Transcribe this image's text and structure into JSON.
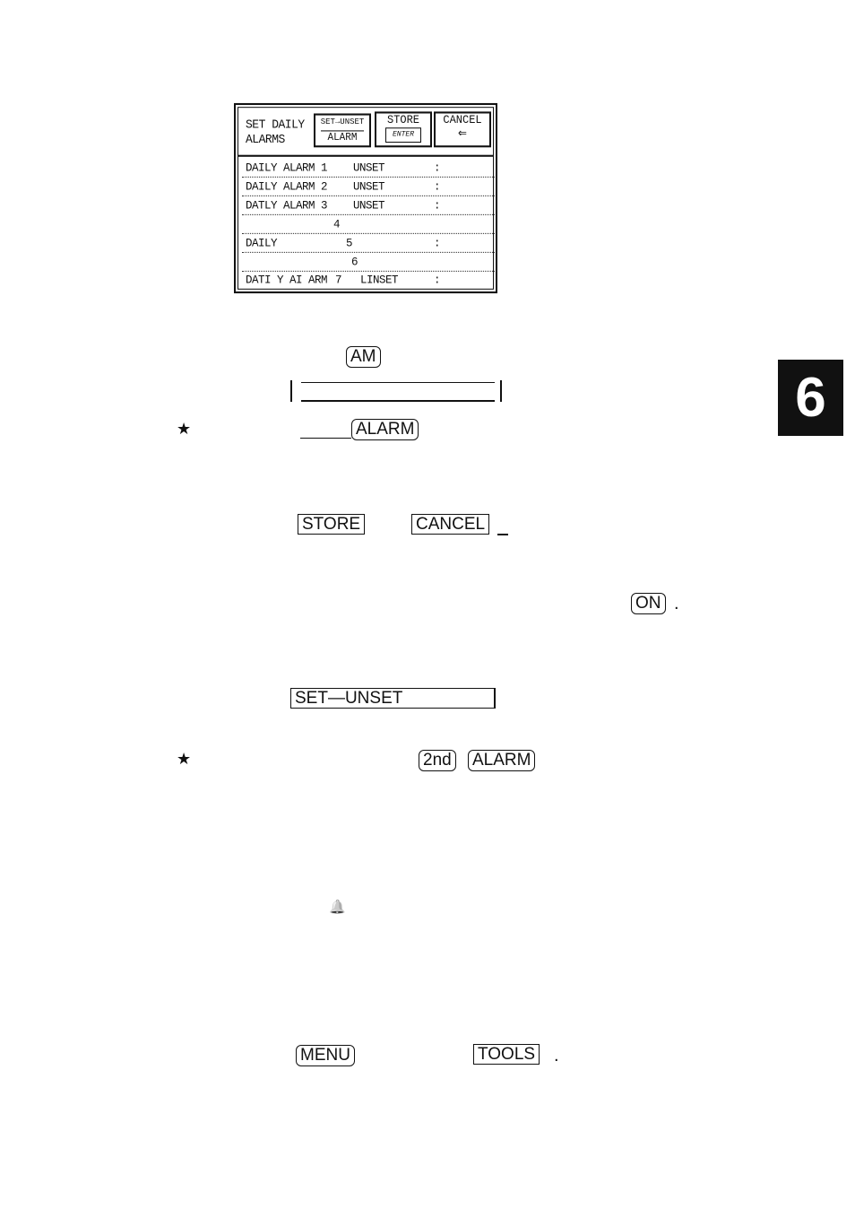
{
  "screen": {
    "title_line1": "SET DAILY",
    "title_line2": "ALARMS",
    "set_unset_key": {
      "top": "SET→UNSET",
      "bottom": "ALARM"
    },
    "store_key": {
      "label": "STORE",
      "sub": "ENTER"
    },
    "cancel_key": {
      "label": "CANCEL"
    },
    "rows": [
      {
        "name": "DAILY ALARM 1",
        "status": "UNSET",
        "time": ":"
      },
      {
        "name": "DAILY ALARM 2",
        "status": "UNSET",
        "time": ":"
      },
      {
        "name": "DATLY ALARM 3",
        "status": "UNSET",
        "time": ":"
      },
      {
        "name": "4",
        "status": "",
        "time": ""
      },
      {
        "name": "DAILY",
        "num": "5",
        "status": "",
        "time": ":"
      },
      {
        "name": "6",
        "status": "",
        "time": ""
      },
      {
        "name": "DATI Y AI ARM",
        "num": "7",
        "status": "LINSET",
        "time": ":"
      }
    ]
  },
  "body": {
    "am_key": "AM",
    "alarm_key": "ALARM",
    "store_box": "STORE",
    "cancel_box": "CANCEL",
    "on_key": "ON",
    "on_period": ".",
    "set_unset_box": "SET—UNSET",
    "second_key": "2nd",
    "alarm_key2": "ALARM",
    "menu_key": "MENU",
    "tools_box": "TOOLS",
    "tools_period": ".",
    "star_symbol": "★",
    "bell_symbol": "🔔"
  },
  "chapter_tab": "6"
}
